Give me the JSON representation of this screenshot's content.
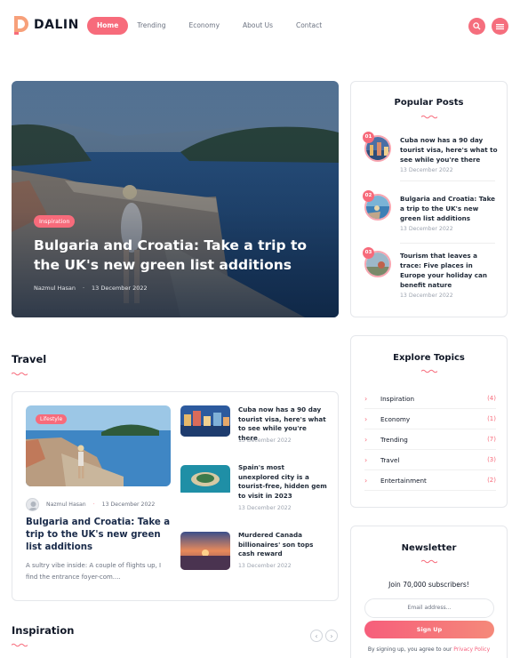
{
  "header": {
    "logo_text": "DALIN",
    "nav": [
      "Home",
      "Trending",
      "Economy",
      "About Us",
      "Contact"
    ],
    "icons": [
      "search-icon",
      "menu-icon"
    ],
    "accent": "#f76b7b"
  },
  "hero": {
    "badge": "Inspiration",
    "title": "Bulgaria and Croatia: Take a trip to the UK's new green list additions",
    "author": "Nazmul Hasan",
    "date": "13 December 2022"
  },
  "popular": {
    "title": "Popular Posts",
    "items": [
      {
        "num": "01",
        "title": "Cuba now has a 90 day tourist visa, here's what to see while you're there",
        "date": "13 December 2022"
      },
      {
        "num": "02",
        "title": "Bulgaria and Croatia: Take a trip to the UK's new green list additions",
        "date": "13 December 2022"
      },
      {
        "num": "03",
        "title": "Tourism that leaves a trace: Five places in Europe your holiday can benefit nature",
        "date": "13 December 2022"
      }
    ]
  },
  "topics": {
    "title": "Explore Topics",
    "items": [
      {
        "label": "Inspiration",
        "count": "(4)"
      },
      {
        "label": "Economy",
        "count": "(1)"
      },
      {
        "label": "Trending",
        "count": "(7)"
      },
      {
        "label": "Travel",
        "count": "(3)"
      },
      {
        "label": "Entertainment",
        "count": "(2)"
      }
    ]
  },
  "newsletter": {
    "title": "Newsletter",
    "subtitle": "Join 70,000 subscribers!",
    "placeholder": "Email address...",
    "button": "Sign Up",
    "note": "By signing up, you agree to our",
    "link": "Privacy Policy"
  },
  "travel": {
    "title": "Travel",
    "main": {
      "badge": "Lifestyle",
      "author": "Nazmul Hasan",
      "date": "13 December 2022",
      "title": "Bulgaria and Croatia: Take a trip to the UK's new green list additions",
      "excerpt": "A sultry vibe inside: A couple of flights up, I find the entrance foyer-com...."
    },
    "posts": [
      {
        "title": "Cuba now has a 90 day tourist visa, here's what to see while you're there",
        "date": "13 December 2022"
      },
      {
        "title": "Spain's most unexplored city is a tourist-free, hidden gem to visit in 2023",
        "date": "13 December 2022"
      },
      {
        "title": "Murdered Canada billionaires' son tops cash reward",
        "date": "13 December 2022"
      }
    ]
  },
  "inspiration": {
    "title": "Inspiration"
  }
}
